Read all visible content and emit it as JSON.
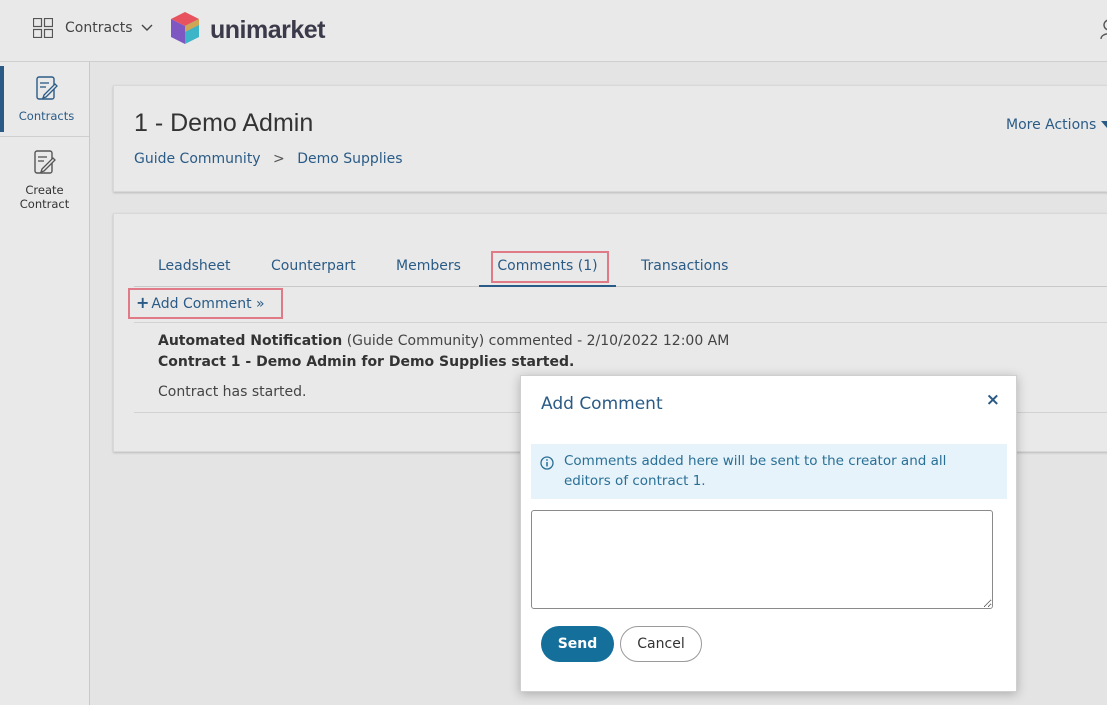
{
  "topbar": {
    "app_switcher_label": "Contracts",
    "logo_text": "unimarket",
    "icons": {
      "apps": "grid-icon",
      "chevron": "chevron-down-icon",
      "user": "user-icon"
    }
  },
  "leftnav": {
    "items": [
      {
        "label": "Contracts",
        "icon": "contract-edit-icon",
        "active": true
      },
      {
        "label": "Create Contract",
        "icon": "contract-create-icon",
        "active": false
      }
    ]
  },
  "header": {
    "title": "1 - Demo Admin",
    "breadcrumb": {
      "first": "Guide Community",
      "separator": ">",
      "second": "Demo Supplies"
    },
    "more_actions_label": "More Actions"
  },
  "tabs": [
    {
      "label": "Leadsheet",
      "active": false
    },
    {
      "label": "Counterpart",
      "active": false
    },
    {
      "label": "Members",
      "active": false
    },
    {
      "label": "Comments (1)",
      "active": true
    },
    {
      "label": "Transactions",
      "active": false
    }
  ],
  "add_comment_label": "Add Comment »",
  "comment": {
    "author": "Automated Notification",
    "meta": " (Guide Community) commented - 2/10/2022 12:00 AM",
    "subject": "Contract 1 - Demo Admin for Demo Supplies started.",
    "body": "Contract has started."
  },
  "modal": {
    "title": "Add Comment",
    "close_label": "×",
    "info_text": "Comments added here will be sent to the creator and all editors of contract 1.",
    "input_value": "",
    "send_label": "Send",
    "cancel_label": "Cancel"
  },
  "colors": {
    "link": "#2a5b86",
    "primary_button": "#156f9b",
    "info_bg": "#e6f3fa",
    "highlight": "#e07a86"
  }
}
